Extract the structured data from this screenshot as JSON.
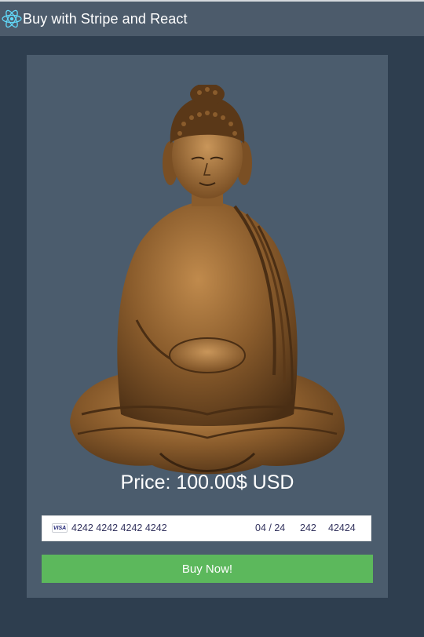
{
  "header": {
    "title": "Buy with Stripe and React",
    "logo_icon": "react-atom-icon"
  },
  "product": {
    "image": "seated-buddha-statue",
    "price_label": "Price: 100.00$ USD"
  },
  "card_form": {
    "brand": "VISA",
    "card_number": "4242 4242 4242 4242",
    "expiry": "04 / 24",
    "cvc": "242",
    "zip": "42424"
  },
  "actions": {
    "buy_label": "Buy Now!"
  },
  "colors": {
    "background": "#2e3e4f",
    "header": "#4c5b6b",
    "card": "#4b5c6d",
    "buy_button": "#5cb85c",
    "react_accent": "#61dafb"
  }
}
